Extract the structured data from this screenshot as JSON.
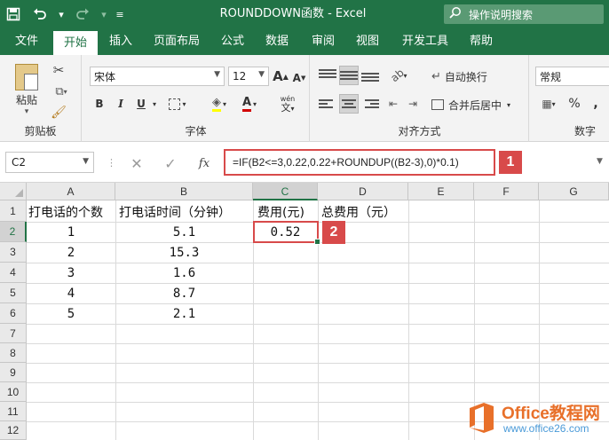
{
  "window": {
    "title": "ROUNDDOWN函数  -  Excel",
    "tell_me": "操作说明搜索"
  },
  "quick_access": {
    "icons": [
      "save-icon",
      "undo-icon",
      "redo-icon",
      "customize-qat-icon"
    ]
  },
  "tabs": [
    "文件",
    "开始",
    "插入",
    "页面布局",
    "公式",
    "数据",
    "审阅",
    "视图",
    "开发工具",
    "帮助"
  ],
  "active_tab": "开始",
  "ribbon": {
    "clipboard": {
      "paste_label": "粘贴",
      "group_label": "剪贴板"
    },
    "font": {
      "font_name": "宋体",
      "font_size": "12",
      "group_label": "字体",
      "bold": "B",
      "italic": "I",
      "underline": "U",
      "font_color_glyph": "A",
      "phonetic_glyph": "wén"
    },
    "alignment": {
      "wrap_text": "自动换行",
      "merge_center": "合并后居中",
      "group_label": "对齐方式"
    },
    "number": {
      "format": "常规",
      "percent": "%",
      "group_label": "数字"
    }
  },
  "formula_bar": {
    "name_box": "C2",
    "fx_label": "fx",
    "formula": "=IF(B2<=3,0.22,0.22+ROUNDUP((B2-3),0)*0.1)"
  },
  "callouts": [
    "1",
    "2"
  ],
  "columns": [
    "A",
    "B",
    "C",
    "D",
    "E",
    "F",
    "G"
  ],
  "rows": [
    "1",
    "2",
    "3",
    "4",
    "5",
    "6",
    "7",
    "8",
    "9",
    "10",
    "11",
    "12"
  ],
  "active_cell": "C2",
  "sheet": {
    "headers": [
      "打电话的个数",
      "打电话时间（分钟）",
      "费用(元)",
      "总费用（元）"
    ],
    "data": [
      {
        "a": "1",
        "b": "5.1",
        "c": "0.52"
      },
      {
        "a": "2",
        "b": "15.3",
        "c": ""
      },
      {
        "a": "3",
        "b": "1.6",
        "c": ""
      },
      {
        "a": "4",
        "b": "8.7",
        "c": ""
      },
      {
        "a": "5",
        "b": "2.1",
        "c": ""
      }
    ]
  },
  "watermark": {
    "brand": "Office教程网",
    "url": "www.office26.com"
  }
}
